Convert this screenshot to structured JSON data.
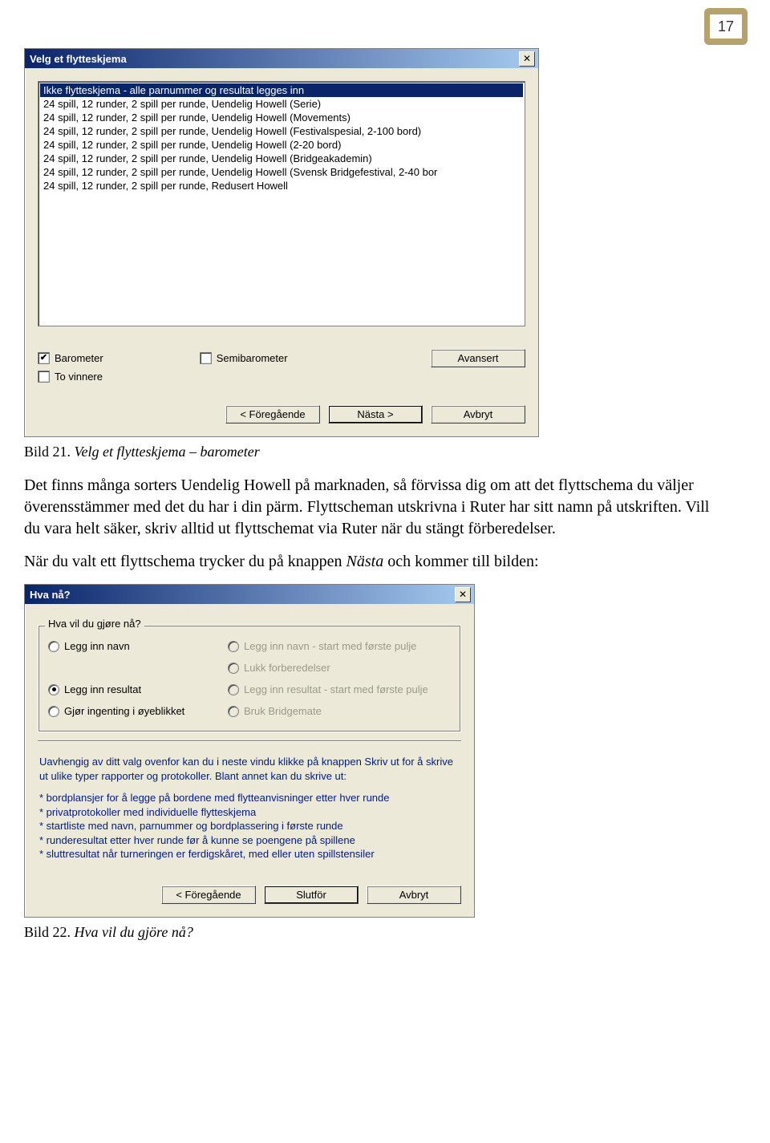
{
  "page_number": "17",
  "dialog1": {
    "title": "Velg et flytteskjema",
    "items": [
      "Ikke flytteskjema - alle parnummer og resultat legges inn",
      "24 spill, 12 runder, 2 spill per runde, Uendelig Howell (Serie)",
      "24 spill, 12 runder, 2 spill per runde, Uendelig Howell (Movements)",
      "24 spill, 12 runder, 2 spill per runde, Uendelig Howell (Festivalspesial, 2-100 bord)",
      "24 spill, 12 runder, 2 spill per runde, Uendelig Howell (2-20 bord)",
      "24 spill, 12 runder, 2 spill per runde, Uendelig Howell (Bridgeakademin)",
      "24 spill, 12 runder, 2 spill per runde, Uendelig Howell (Svensk Bridgefestival, 2-40 bor",
      "24 spill, 12 runder, 2 spill per runde, Redusert Howell"
    ],
    "selected_index": 0,
    "barometer_label": "Barometer",
    "barometer_checked": true,
    "semibarometer_label": "Semibarometer",
    "semibarometer_checked": false,
    "tovinnere_label": "To vinnere",
    "tovinnere_checked": false,
    "avansert_label": "Avansert",
    "prev_label": "< Föregående",
    "next_label": "Nästa >",
    "cancel_label": "Avbryt"
  },
  "caption1_num": "Bild 21.",
  "caption1_title": "Velg et flytteskjema – barometer",
  "para1": "Det finns många sorters Uendelig Howell på marknaden, så förvissa dig om att det flyttschema du väljer överensstämmer med det du har i din pärm. Flyttscheman utskrivna i Ruter har sitt namn på utskriften. Vill du vara helt säker, skriv alltid ut flyttschemat via Ruter när du stängt förberedelser.",
  "para2_a": "När du valt ett flyttschema trycker du på knappen ",
  "para2_b": "Nästa",
  "para2_c": " och kommer till bilden:",
  "dialog2": {
    "title": "Hva nå?",
    "group_title": "Hva vil du gjøre nå?",
    "radios": {
      "legg_inn_navn": "Legg inn navn",
      "legg_inn_navn_pulje": "Legg inn navn - start med første pulje",
      "lukk_forberedelser": "Lukk forberedelser",
      "legg_inn_resultat": "Legg inn resultat",
      "legg_inn_resultat_pulje": "Legg inn resultat - start med første pulje",
      "gjor_ingenting": "Gjør ingenting i øyeblikket",
      "bruk_bridgemate": "Bruk Bridgemate"
    },
    "info_lead": "Uavhengig av ditt valg ovenfor kan du i neste vindu klikke på knappen Skriv ut for å skrive ut ulike typer rapporter og protokoller. Blant annet kan du skrive ut:",
    "info_items": [
      "bordplansjer for å legge på bordene med flytteanvisninger etter hver runde",
      "privatprotokoller med individuelle flytteskjema",
      "startliste med navn, parnummer og bordplassering i første runde",
      "runderesultat etter hver runde før å kunne se poengene på spillene",
      "sluttresultat når turneringen er ferdigskåret, med eller uten spillstensiler"
    ],
    "prev_label": "< Föregående",
    "finish_label": "Slutför",
    "cancel_label": "Avbryt"
  },
  "caption2_num": "Bild 22.",
  "caption2_title": "Hva vil du gjöre nå?"
}
